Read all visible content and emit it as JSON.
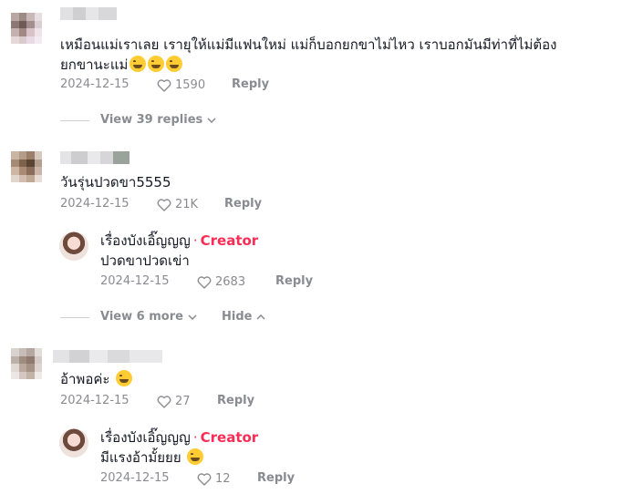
{
  "comments": [
    {
      "text": "เหมือนแม่เราเลย เรายุให้แม่มีแฟนใหม่ แม่ก็บอกยกขาไม่ไหว เราบอกมันมีท่าที่ไม่ต้อง",
      "text_line2": "ยกขานะแม่",
      "emoji": "😂😂😂",
      "date": "2024-12-15",
      "likes": "1590",
      "reply_label": "Reply",
      "view_replies_label": "View 39 replies"
    },
    {
      "text": "วันรุ่นปวดขา5555",
      "date": "2024-12-15",
      "likes": "21K",
      "reply_label": "Reply",
      "replies": [
        {
          "author": "เรื่องบังเอิ๊ญญญ",
          "separator": "·",
          "badge": "Creator",
          "text": "ปวดขาปวดเข่า",
          "date": "2024-12-15",
          "likes": "2683",
          "reply_label": "Reply"
        }
      ],
      "view_more_label": "View 6 more",
      "hide_label": "Hide"
    },
    {
      "text": "อ้าพอค่ะ",
      "emoji": "🤣",
      "date": "2024-12-15",
      "likes": "27",
      "reply_label": "Reply",
      "replies": [
        {
          "author": "เรื่องบังเอิ๊ญญญ",
          "separator": "·",
          "badge": "Creator",
          "text": "มีแรงอ้ามั้ยยย",
          "emoji": "😂",
          "date": "2024-12-15",
          "likes": "12",
          "reply_label": "Reply"
        }
      ]
    }
  ],
  "colors": {
    "accent": "#fe2c55",
    "muted": "#8a8b91",
    "text": "#161823"
  },
  "icons": {
    "like": "heart-outline-icon",
    "expand": "chevron-down-icon",
    "collapse": "chevron-up-icon"
  }
}
